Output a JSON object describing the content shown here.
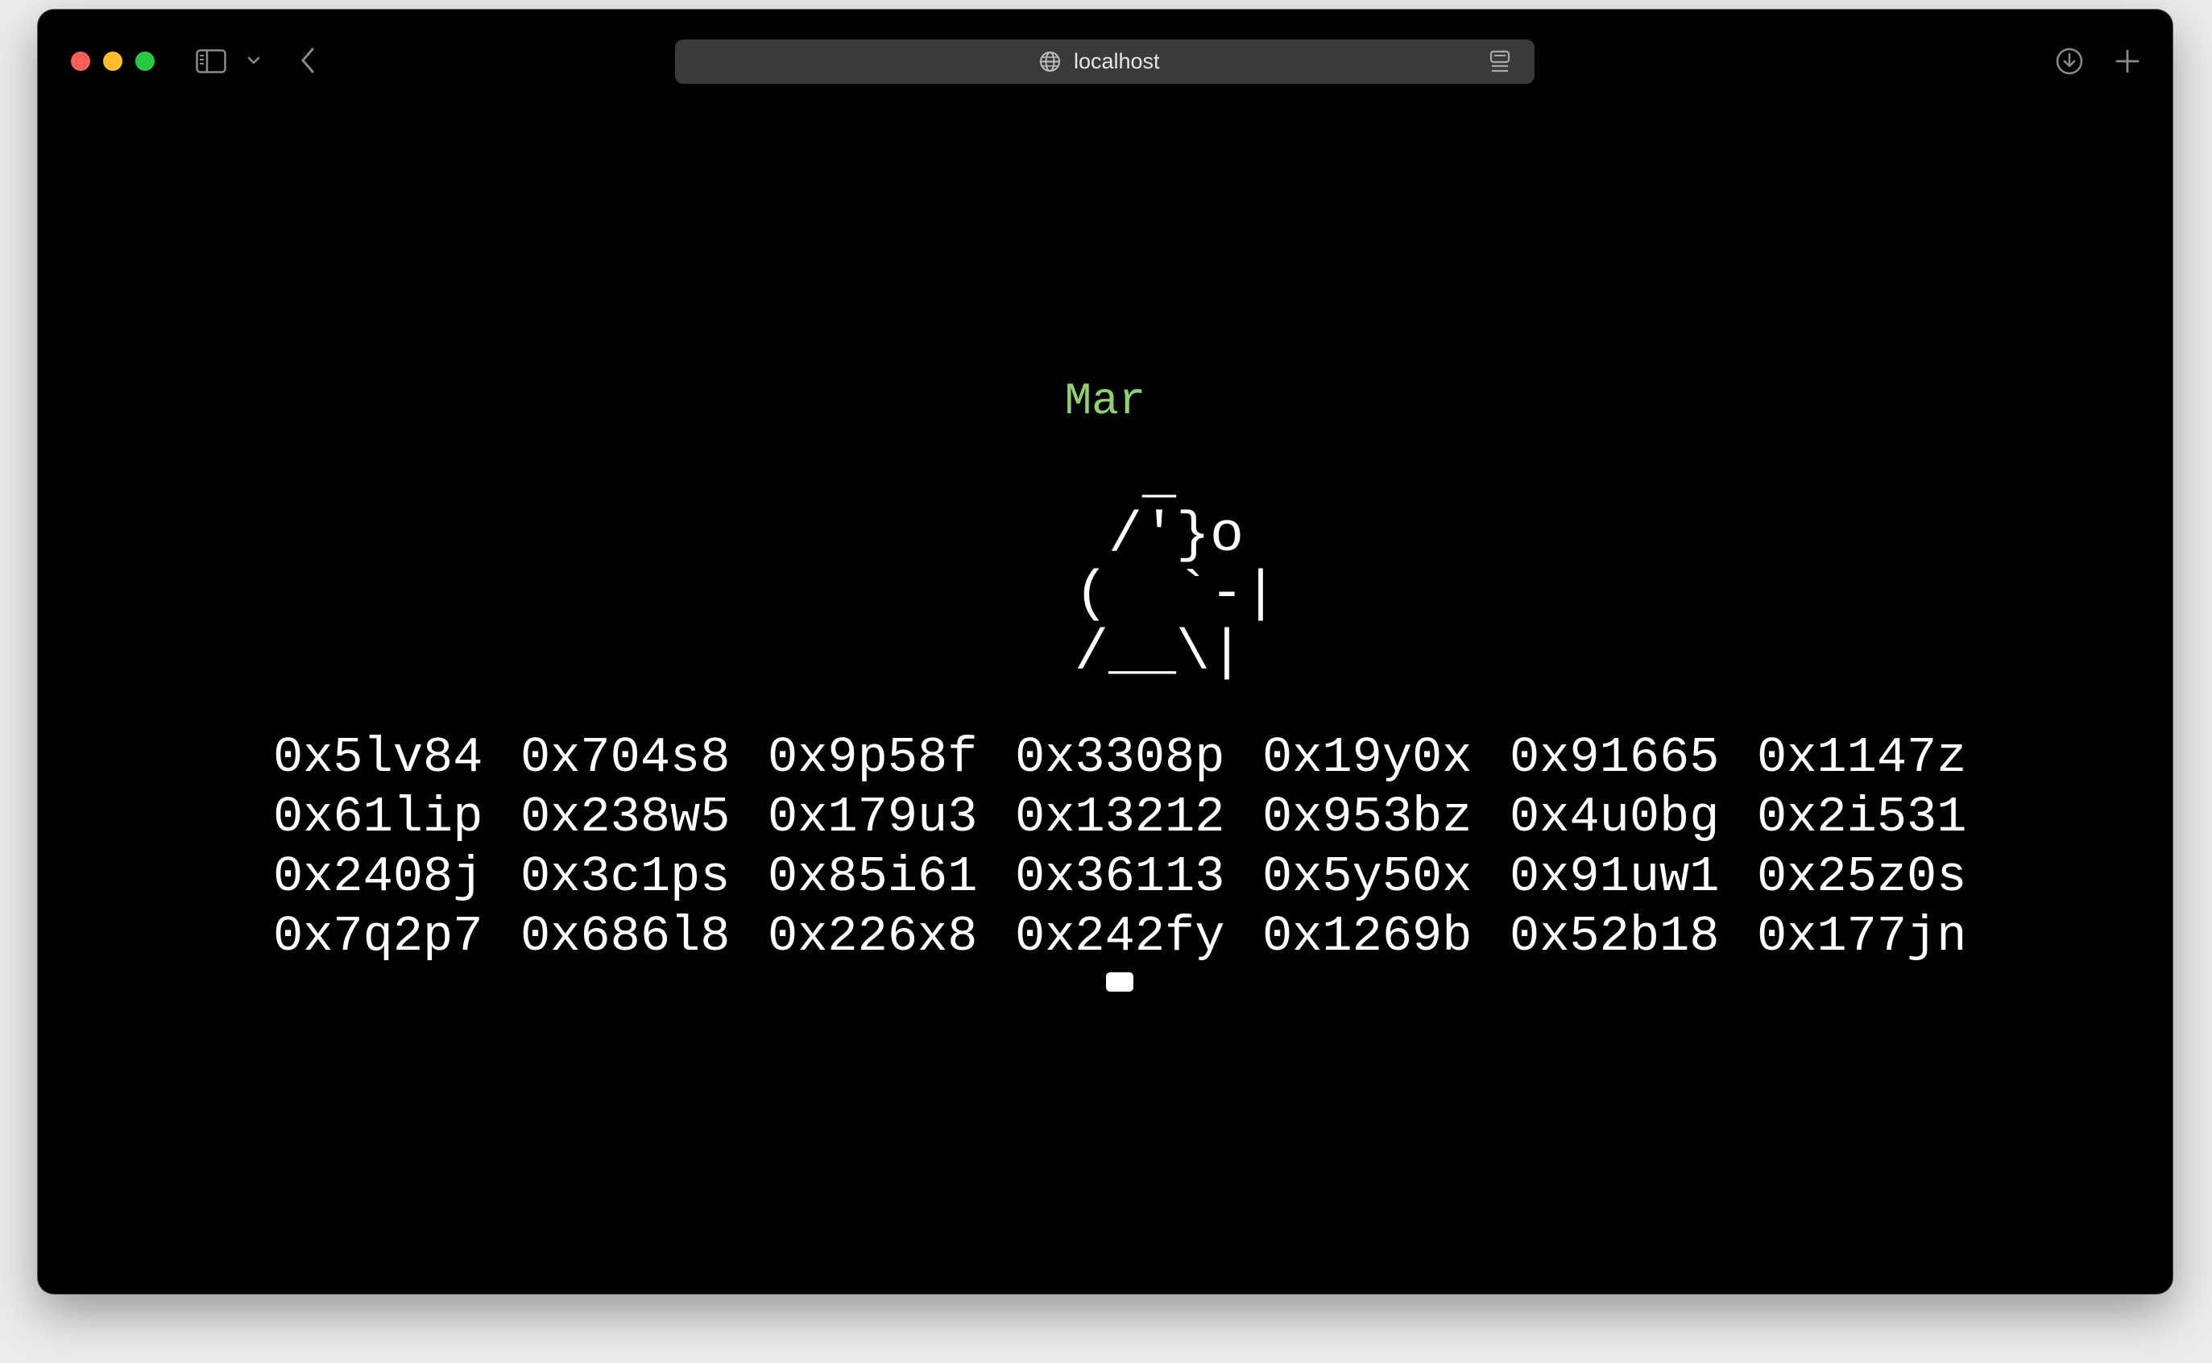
{
  "browser": {
    "url": "localhost"
  },
  "terminal": {
    "character_name": "Mar",
    "ascii_art": "   _\n  /'}o\n (  `-|\n /__\\|",
    "hex_rows": [
      [
        "0x5lv84",
        "0x704s8",
        "0x9p58f",
        "0x3308p",
        "0x19y0x",
        "0x91665",
        "0x1147z"
      ],
      [
        "0x61lip",
        "0x238w5",
        "0x179u3",
        "0x13212",
        "0x953bz",
        "0x4u0bg",
        "0x2i531"
      ],
      [
        "0x2408j",
        "0x3c1ps",
        "0x85i61",
        "0x36113",
        "0x5y50x",
        "0x91uw1",
        "0x25z0s"
      ],
      [
        "0x7q2p7",
        "0x686l8",
        "0x226x8",
        "0x242fy",
        "0x1269b",
        "0x52b18",
        "0x177jn"
      ]
    ]
  },
  "colors": {
    "background": "#000000",
    "name_color": "#8fd16b",
    "text_color": "#ffffff"
  }
}
